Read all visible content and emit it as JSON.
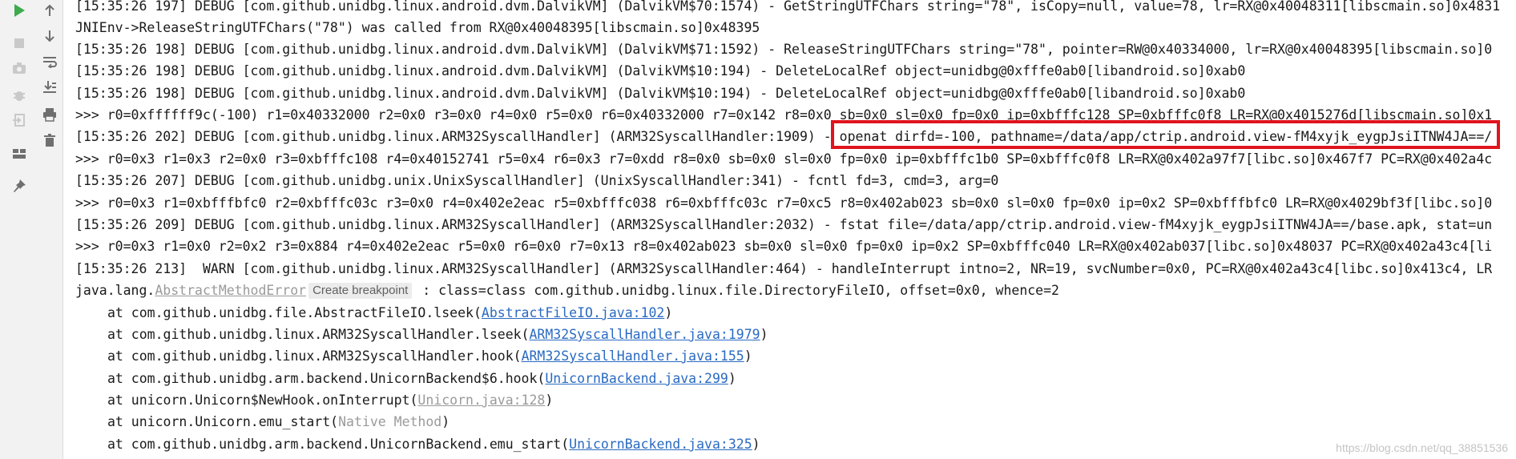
{
  "toolbar": {
    "icons": [
      "run-icon",
      "stop-icon",
      "camera-icon",
      "debug-bug-icon",
      "exit-icon",
      "layout-icon",
      "pin-icon",
      "up-arrow-icon",
      "down-arrow-icon",
      "soft-wrap-icon",
      "scroll-to-end-icon",
      "print-icon",
      "trash-icon"
    ],
    "accent_color": "#3dab4e"
  },
  "console": {
    "lines": [
      {
        "text": "[15:35:26 197] DEBUG [com.github.unidbg.linux.android.dvm.DalvikVM] (DalvikVM$70:1574) - GetStringUTFChars string=\"78\", isCopy=null, value=78, lr=RX@0x40048311[libscmain.so]0x4831"
      },
      {
        "text": "JNIEnv->ReleaseStringUTFChars(\"78\") was called from RX@0x40048395[libscmain.so]0x48395"
      },
      {
        "text": "[15:35:26 198] DEBUG [com.github.unidbg.linux.android.dvm.DalvikVM] (DalvikVM$71:1592) - ReleaseStringUTFChars string=\"78\", pointer=RW@0x40334000, lr=RX@0x40048395[libscmain.so]0"
      },
      {
        "text": "[15:35:26 198] DEBUG [com.github.unidbg.linux.android.dvm.DalvikVM] (DalvikVM$10:194) - DeleteLocalRef object=unidbg@0xfffe0ab0[libandroid.so]0xab0"
      },
      {
        "text": "[15:35:26 198] DEBUG [com.github.unidbg.linux.android.dvm.DalvikVM] (DalvikVM$10:194) - DeleteLocalRef object=unidbg@0xfffe0ab0[libandroid.so]0xab0"
      },
      {
        "text": ">>> r0=0xffffff9c(-100) r1=0x40332000 r2=0x0 r3=0x0 r4=0x0 r5=0x0 r6=0x40332000 r7=0x142 r8=0x0 sb=0x0 sl=0x0 fp=0x0 ip=0xbfffc128 SP=0xbfffc0f8 LR=RX@0x4015276d[libscmain.so]0x1"
      },
      {
        "text": "[15:35:26 202] DEBUG [com.github.unidbg.linux.ARM32SyscallHandler] (ARM32SyscallHandler:1909) - openat dirfd=-100, pathname=/data/app/ctrip.android.view-fM4xyjk_eygpJsiITNW4JA==/"
      },
      {
        "text": ">>> r0=0x3 r1=0x3 r2=0x0 r3=0xbfffc108 r4=0x40152741 r5=0x4 r6=0x3 r7=0xdd r8=0x0 sb=0x0 sl=0x0 fp=0x0 ip=0xbfffc1b0 SP=0xbfffc0f8 LR=RX@0x402a97f7[libc.so]0x467f7 PC=RX@0x402a4c"
      },
      {
        "text": "[15:35:26 207] DEBUG [com.github.unidbg.unix.UnixSyscallHandler] (UnixSyscallHandler:341) - fcntl fd=3, cmd=3, arg=0"
      },
      {
        "text": ">>> r0=0x3 r1=0xbfffbfc0 r2=0xbfffc03c r3=0x0 r4=0x402e2eac r5=0xbfffc038 r6=0xbfffc03c r7=0xc5 r8=0x402ab023 sb=0x0 sl=0x0 fp=0x0 ip=0x2 SP=0xbfffbfc0 LR=RX@0x4029bf3f[libc.so]0"
      },
      {
        "text": "[15:35:26 209] DEBUG [com.github.unidbg.linux.ARM32SyscallHandler] (ARM32SyscallHandler:2032) - fstat file=/data/app/ctrip.android.view-fM4xyjk_eygpJsiITNW4JA==/base.apk, stat=un"
      },
      {
        "text": ">>> r0=0x3 r1=0x0 r2=0x2 r3=0x884 r4=0x402e2eac r5=0x0 r6=0x0 r7=0x13 r8=0x402ab023 sb=0x0 sl=0x0 fp=0x0 ip=0x2 SP=0xbfffc040 LR=RX@0x402ab037[libc.so]0x48037 PC=RX@0x402a43c4[li"
      },
      {
        "text": "[15:35:26 213]  WARN [com.github.unidbg.linux.ARM32SyscallHandler] (ARM32SyscallHandler:464) - handleInterrupt intno=2, NR=19, svcNumber=0x0, PC=RX@0x402a43c4[libc.so]0x413c4, LR"
      }
    ],
    "exception": {
      "prefix": "java.lang.",
      "class_name": "AbstractMethodError",
      "tooltip": "Create breakpoint",
      "suffix": " : class=class com.github.unidbg.linux.file.DirectoryFileIO, offset=0x0, whence=2"
    },
    "stack": [
      {
        "prefix": "at com.github.unidbg.file.AbstractFileIO.lseek(",
        "link": "AbstractFileIO.java:102",
        "suffix": ")",
        "style": "link"
      },
      {
        "prefix": "at com.github.unidbg.linux.ARM32SyscallHandler.lseek(",
        "link": "ARM32SyscallHandler.java:1979",
        "suffix": ")",
        "style": "link"
      },
      {
        "prefix": "at com.github.unidbg.linux.ARM32SyscallHandler.hook(",
        "link": "ARM32SyscallHandler.java:155",
        "suffix": ")",
        "style": "link"
      },
      {
        "prefix": "at com.github.unidbg.arm.backend.UnicornBackend$6.hook(",
        "link": "UnicornBackend.java:299",
        "suffix": ")",
        "style": "link"
      },
      {
        "prefix": "at unicorn.Unicorn$NewHook.onInterrupt(",
        "link": "Unicorn.java:128",
        "suffix": ")",
        "style": "link-gray"
      },
      {
        "prefix": "at unicorn.Unicorn.emu_start(",
        "link": "Native Method",
        "suffix": ")",
        "style": "native"
      },
      {
        "prefix": "at com.github.unidbg.arm.backend.UnicornBackend.emu_start(",
        "link": "UnicornBackend.java:325",
        "suffix": ")",
        "style": "link"
      }
    ],
    "highlight_color": "#e0141e"
  },
  "watermark": "https://blog.csdn.net/qq_38851536"
}
